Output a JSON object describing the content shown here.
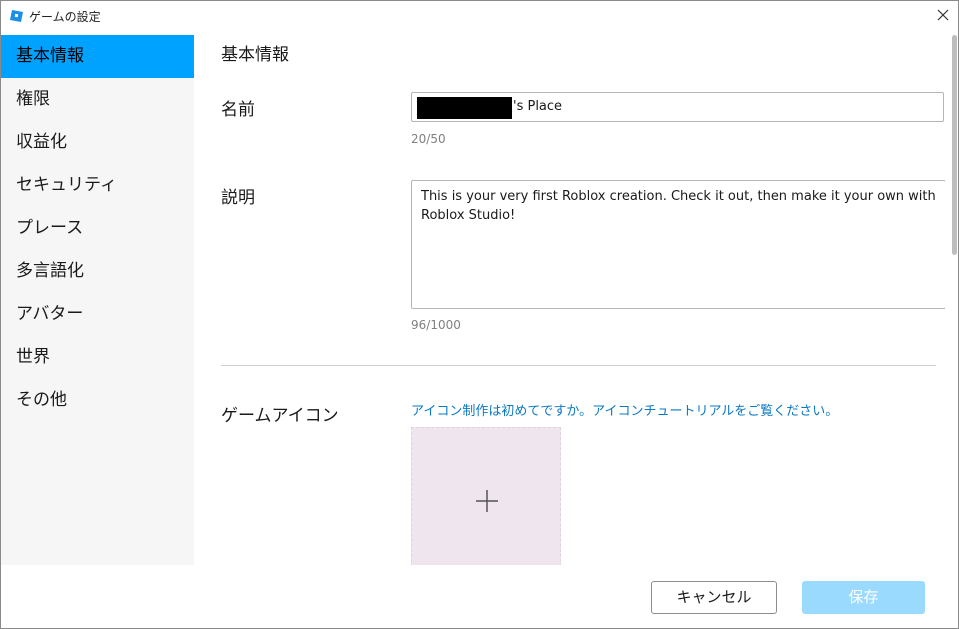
{
  "window": {
    "title": "ゲームの設定"
  },
  "sidebar": {
    "items": [
      {
        "label": "基本情報",
        "active": true
      },
      {
        "label": "権限",
        "active": false
      },
      {
        "label": "収益化",
        "active": false
      },
      {
        "label": "セキュリティ",
        "active": false
      },
      {
        "label": "プレース",
        "active": false
      },
      {
        "label": "多言語化",
        "active": false
      },
      {
        "label": "アバター",
        "active": false
      },
      {
        "label": "世界",
        "active": false
      },
      {
        "label": "その他",
        "active": false
      }
    ]
  },
  "main": {
    "section_title": "基本情報",
    "name": {
      "label": "名前",
      "value": "'s Place",
      "counter": "20/50"
    },
    "description": {
      "label": "説明",
      "value": "This is your very first Roblox creation. Check it out, then make it your own with Roblox Studio!",
      "counter": "96/1000"
    },
    "game_icon": {
      "label": "ゲームアイコン",
      "tutorial_link": "アイコン制作は初めてですか。アイコンチュートリアルをご覧ください。"
    }
  },
  "footer": {
    "cancel_label": "キャンセル",
    "save_label": "保存"
  },
  "colors": {
    "accent": "#00a2ff",
    "link": "#0a78c2",
    "save_disabled": "#9bdaff",
    "icon_placeholder": "#eee5ee"
  },
  "icons": {
    "app": "roblox-studio-icon",
    "close": "close-icon",
    "add": "plus-icon"
  }
}
